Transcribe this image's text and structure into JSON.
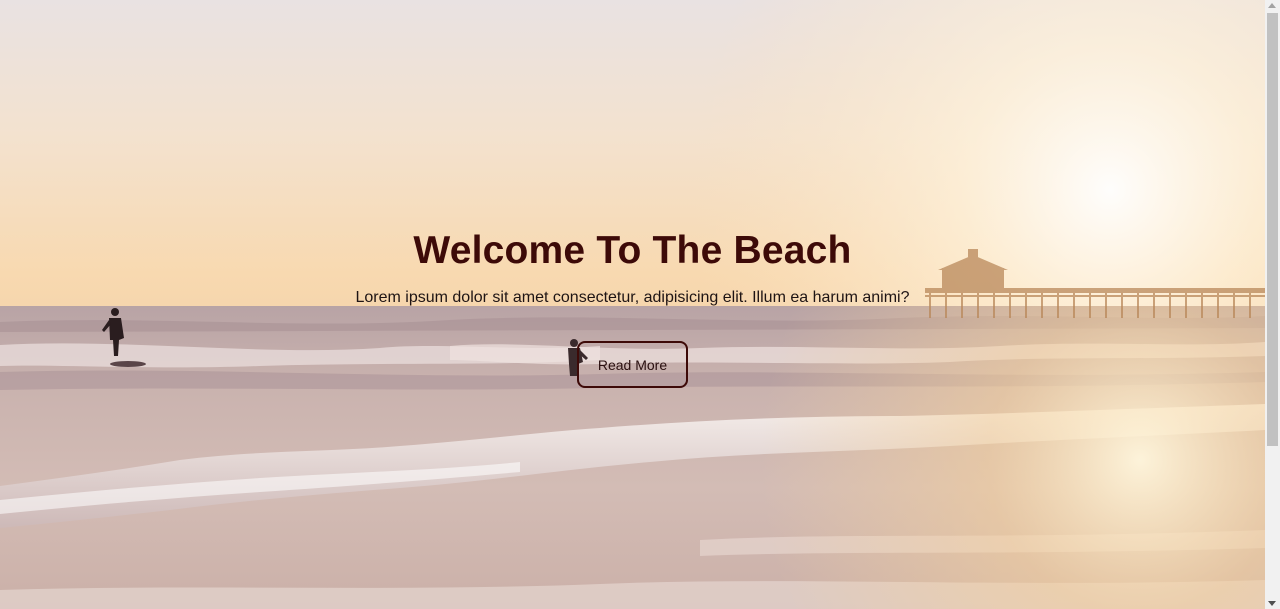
{
  "hero": {
    "title": "Welcome To The Beach",
    "text": "Lorem ipsum dolor sit amet consectetur, adipisicing elit. Illum ea harum animi?",
    "button_label": "Read More"
  },
  "colors": {
    "title": "#3d0a08",
    "button_border": "#3d0a08",
    "text": "#1e1414"
  },
  "background": {
    "icon": "beach-sunset-photo"
  }
}
